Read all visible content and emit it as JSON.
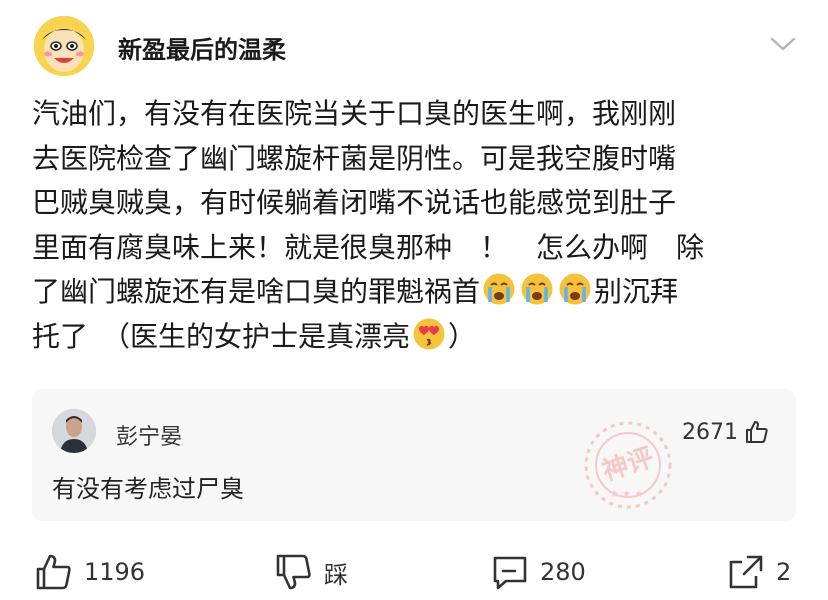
{
  "author": {
    "name": "新盈最后的温柔"
  },
  "post": {
    "lines": [
      "汽油们，有没有在医院当关于口臭的医生啊，我刚刚",
      "去医院检查了幽门螺旋杆菌是阴性。可是我空腹时嘴",
      "巴贼臭贼臭，有时候躺着闭嘴不说话也能感觉到肚子",
      "里面有腐臭味上来！就是很臭那种　！　怎么办啊　除"
    ],
    "line5_text": "了幽门螺旋还有是啥口臭的罪魁祸首",
    "line5_tail": "别沉拜",
    "line6_text": "托了　（医生的女护士是真漂亮",
    "line6_tail": "）"
  },
  "hot_comment": {
    "user": "彭宁晏",
    "likes": "2671",
    "text": "有没有考虑过尸臭",
    "stamp_text": "神评"
  },
  "actions": {
    "like_count": "1196",
    "dislike_label": "踩",
    "comment_count": "280",
    "share_count": "2"
  },
  "colors": {
    "emoji_yellow": "#f5c23c",
    "stamp_red": "#f0a7a0",
    "card_bg": "#f7f7f7"
  }
}
